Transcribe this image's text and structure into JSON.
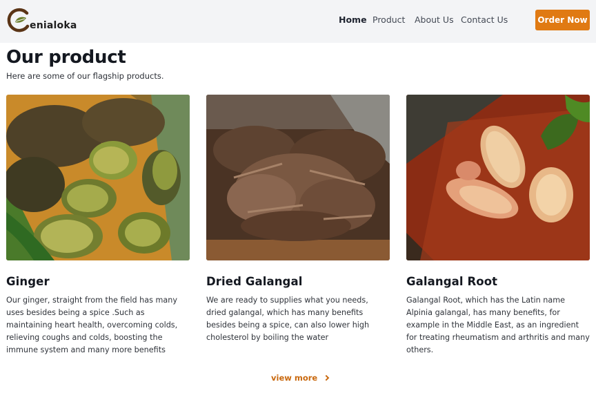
{
  "nav": {
    "brand_text": "enialoka",
    "links": [
      {
        "label": "Home",
        "active": true
      },
      {
        "label": "Product",
        "active": false
      },
      {
        "label": "About Us",
        "active": false
      },
      {
        "label": "Contact Us",
        "active": false
      }
    ],
    "cta_label": "Order Now",
    "accent_color": "#e07a13",
    "background_color": "#f3f4f6"
  },
  "section": {
    "title": "Our product",
    "subtitle": "Here are some of our flagship products."
  },
  "products": [
    {
      "name": "Ginger",
      "description": "Our ginger, straight from the field has many uses besides being a spice .Such as maintaining heart health, overcoming colds, relieving coughs and colds, boosting the immune system and many more benefits",
      "image": "ginger-photo"
    },
    {
      "name": "Dried Galangal",
      "description": "We are ready to supplies what you needs, dried galangal, which has many benefits besides being a spice, can also lower high cholesterol by boiling the water",
      "image": "dried-galangal-photo"
    },
    {
      "name": "Galangal Root",
      "description": "Galangal Root, which has the Latin name Alpinia galangal, has many benefits, for example in the Middle East, as an ingredient for treating rheumatism and arthritis and many others.",
      "image": "galangal-root-photo"
    }
  ],
  "footer": {
    "view_more_label": "view more",
    "view_more_icon": "chevron-right-icon"
  }
}
